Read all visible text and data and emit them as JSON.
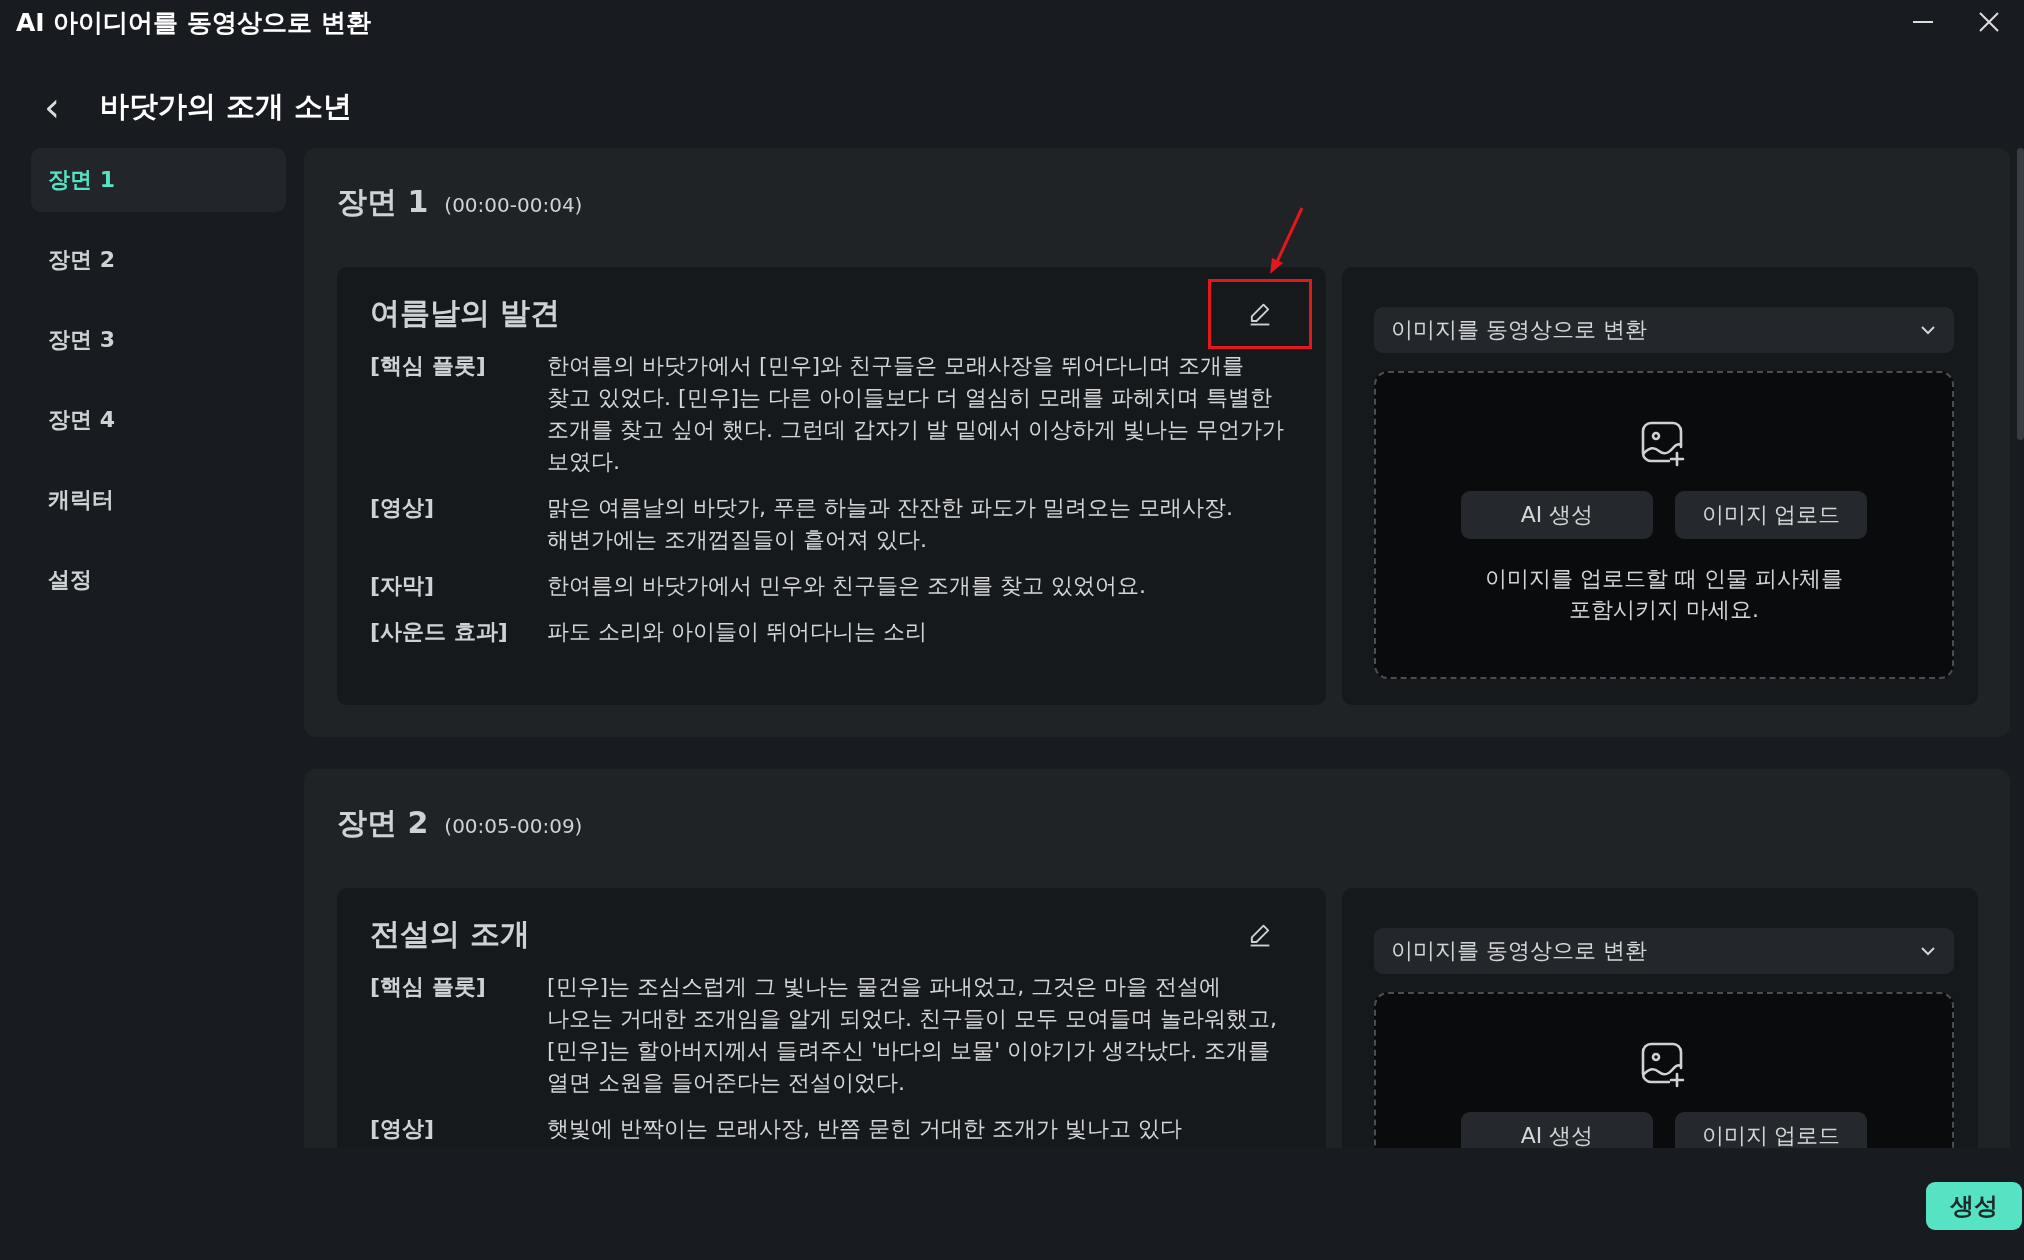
{
  "window": {
    "title": "AI 아이디어를 동영상으로 변환"
  },
  "header": {
    "back_icon": "‹",
    "title": "바닷가의 조개 소년"
  },
  "sidebar": {
    "items": [
      {
        "label": "장면 1",
        "selected": true
      },
      {
        "label": "장면 2",
        "selected": false
      },
      {
        "label": "장면 3",
        "selected": false
      },
      {
        "label": "장면 4",
        "selected": false
      },
      {
        "label": "캐릭터",
        "selected": false
      },
      {
        "label": "설정",
        "selected": false
      }
    ]
  },
  "scenes": [
    {
      "name": "장면 1",
      "time": "(00:00-00:04)",
      "card_title": "여름날의 발견",
      "edit_highlighted": true,
      "rows": [
        {
          "label": "[핵심 플롯]",
          "text": "한여름의 바닷가에서 [민우]와 친구들은 모래사장을 뛰어다니며 조개를 찾고 있었다. [민우]는 다른 아이들보다 더 열심히 모래를 파헤치며 특별한 조개를 찾고 싶어 했다. 그런데 갑자기 발 밑에서 이상하게 빛나는 무언가가 보였다."
        },
        {
          "label": "[영상]",
          "text": "맑은 여름날의 바닷가, 푸른 하늘과 잔잔한 파도가 밀려오는 모래사장. 해변가에는 조개껍질들이 흩어져 있다."
        },
        {
          "label": "[자막]",
          "text": "한여름의 바닷가에서 민우와 친구들은 조개를 찾고 있었어요."
        },
        {
          "label": "[사운드 효과]",
          "text": "파도 소리와 아이들이 뛰어다니는 소리"
        }
      ],
      "mode": "이미지를 동영상으로 변환",
      "buttons": [
        "AI 생성",
        "이미지 업로드"
      ],
      "hint": "이미지를 업로드할 때 인물 피사체를 포함시키지 마세요."
    },
    {
      "name": "장면 2",
      "time": "(00:05-00:09)",
      "card_title": "전설의 조개",
      "edit_highlighted": false,
      "rows": [
        {
          "label": "[핵심 플롯]",
          "text": "[민우]는 조심스럽게 그 빛나는 물건을 파내었고, 그것은 마을 전설에 나오는 거대한 조개임을 알게 되었다. 친구들이 모두 모여들며 놀라워했고, [민우]는 할아버지께서 들려주신 '바다의 보물' 이야기가 생각났다. 조개를 열면 소원을 들어준다는 전설이었다."
        },
        {
          "label": "[영상]",
          "text": "햇빛에 반짝이는 모래사장, 반쯤 묻힌 거대한 조개가 빛나고 있다"
        }
      ],
      "mode": "이미지를 동영상으로 변환",
      "buttons": [
        "AI 생성",
        "이미지 업로드"
      ]
    }
  ],
  "footer": {
    "generate_button": "생성"
  }
}
